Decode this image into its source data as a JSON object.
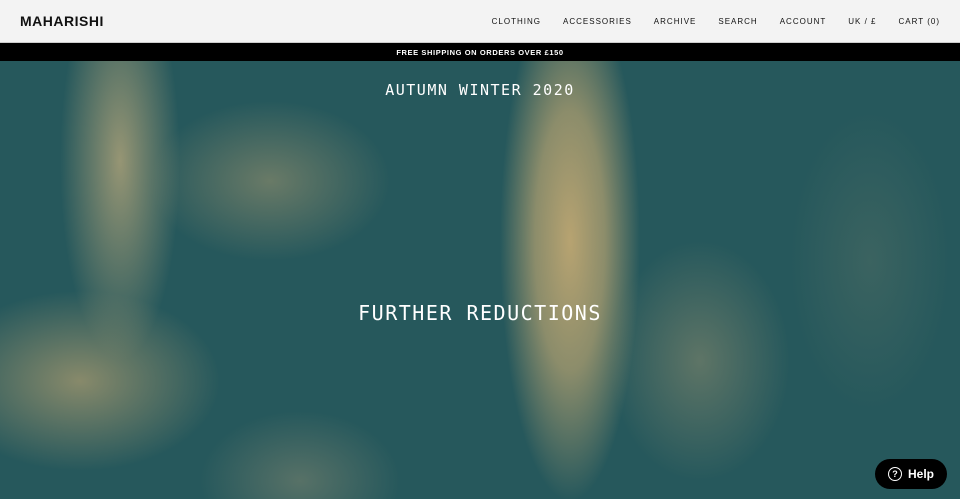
{
  "header": {
    "logo": "MAHARISHI",
    "nav": [
      "CLOTHING",
      "ACCESSORIES",
      "ARCHIVE",
      "SEARCH",
      "ACCOUNT",
      "UK / £",
      "CART (0)"
    ]
  },
  "banner": "FREE SHIPPING ON ORDERS OVER £150",
  "hero": {
    "season": "AUTUMN WINTER 2020",
    "headline": "FURTHER REDUCTIONS"
  },
  "help": {
    "icon": "question-circle-icon",
    "label": "Help"
  }
}
